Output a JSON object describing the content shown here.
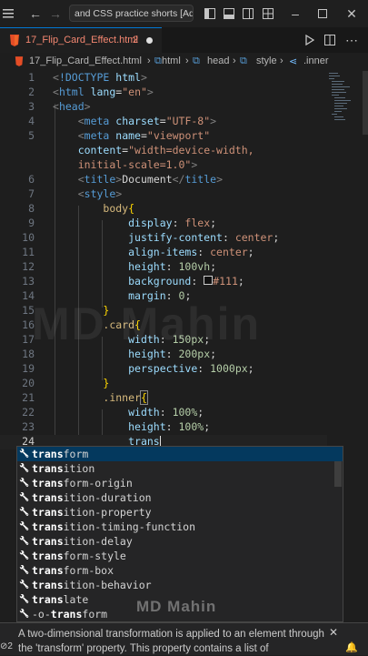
{
  "titlebar": {
    "search_text": "and CSS practice shorts [Adm",
    "icons": [
      "menu-icon",
      "back-arrow-icon",
      "forward-arrow-icon",
      "layout-sidebar-icon",
      "layout-panel-icon",
      "layout-sidebar-right-icon",
      "layout-customize-icon",
      "minimize-icon",
      "maximize-icon",
      "close-icon"
    ]
  },
  "tab": {
    "label": "17_Flip_Card_Effect.html",
    "badge": "2",
    "accent": "#f48771"
  },
  "breadcrumb": {
    "items": [
      "17_Flip_Card_Effect.html",
      "html",
      "head",
      "style",
      ".inner"
    ]
  },
  "editor": {
    "line_numbers": [
      "1",
      "2",
      "3",
      "4",
      "5",
      "",
      "6",
      "7",
      "8",
      "9",
      "10",
      "11",
      "12",
      "13",
      "14",
      "15",
      "16",
      "17",
      "18",
      "19",
      "20",
      "21",
      "22",
      "23",
      "24"
    ],
    "current_line": "24"
  },
  "suggest": {
    "typed": "trans",
    "items": [
      {
        "match": "trans",
        "rest": "form"
      },
      {
        "match": "trans",
        "rest": "ition"
      },
      {
        "match": "trans",
        "rest": "form-origin"
      },
      {
        "match": "trans",
        "rest": "ition-duration"
      },
      {
        "match": "trans",
        "rest": "ition-property"
      },
      {
        "match": "trans",
        "rest": "ition-timing-function"
      },
      {
        "match": "trans",
        "rest": "ition-delay"
      },
      {
        "match": "trans",
        "rest": "form-style"
      },
      {
        "match": "trans",
        "rest": "form-box"
      },
      {
        "match": "trans",
        "rest": "ition-behavior"
      },
      {
        "match": "trans",
        "rest": "late"
      },
      {
        "prefix": "-o-",
        "match": "trans",
        "rest": "form"
      }
    ]
  },
  "docs": {
    "text": "A two-dimensional transformation is applied to an element through the 'transform' property. This property contains a list of",
    "left_badge": "2"
  },
  "watermarks": {
    "big": "MD Mahin",
    "small": "MD Mahin"
  },
  "colors": {
    "background": "#1e1e1e",
    "tag": "#569cd6",
    "attribute": "#9cdcfe",
    "string": "#ce9178",
    "selector": "#d7ba7d",
    "number": "#b5cea8"
  }
}
